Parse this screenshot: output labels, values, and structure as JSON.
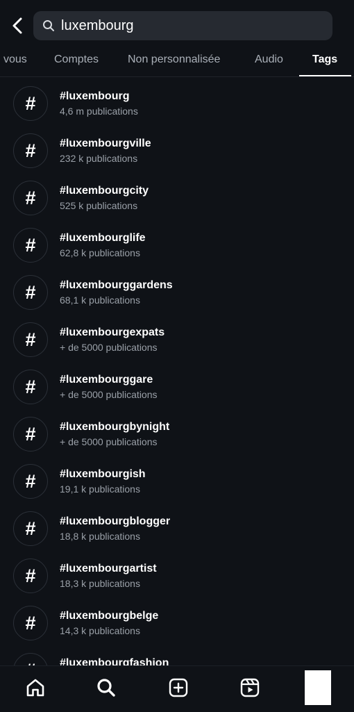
{
  "search": {
    "value": "luxembourg",
    "back_icon": "chevron-left-icon",
    "search_icon": "magnifier-icon"
  },
  "tabs": [
    {
      "label": "vous",
      "active": false
    },
    {
      "label": "Comptes",
      "active": false
    },
    {
      "label": "Non personnalisée",
      "active": false
    },
    {
      "label": "Audio",
      "active": false
    },
    {
      "label": "Tags",
      "active": true
    }
  ],
  "tag_symbol": "#",
  "results": [
    {
      "name": "#luxembourg",
      "count": "4,6 m publications"
    },
    {
      "name": "#luxembourgville",
      "count": "232 k publications"
    },
    {
      "name": "#luxembourgcity",
      "count": "525 k publications"
    },
    {
      "name": "#luxembourglife",
      "count": "62,8 k publications"
    },
    {
      "name": "#luxembourggardens",
      "count": "68,1 k publications"
    },
    {
      "name": "#luxembourgexpats",
      "count": "+ de 5000 publications"
    },
    {
      "name": "#luxembourggare",
      "count": "+ de 5000 publications"
    },
    {
      "name": "#luxembourgbynight",
      "count": "+ de 5000 publications"
    },
    {
      "name": "#luxembourgish",
      "count": "19,1 k publications"
    },
    {
      "name": "#luxembourgblogger",
      "count": "18,8 k publications"
    },
    {
      "name": "#luxembourgartist",
      "count": "18,3 k publications"
    },
    {
      "name": "#luxembourgbelge",
      "count": "14,3 k publications"
    },
    {
      "name": "#luxembourgfashion",
      "count": ""
    }
  ],
  "bottom_nav": [
    {
      "icon": "home-icon"
    },
    {
      "icon": "search-icon"
    },
    {
      "icon": "create-plus-icon"
    },
    {
      "icon": "reels-icon"
    },
    {
      "icon": "profile-avatar"
    }
  ],
  "colors": {
    "background": "#0f1217",
    "search_bg": "#262a31",
    "text_primary": "#ffffff",
    "text_secondary": "#9aa0a8",
    "tab_inactive": "#aab0b8"
  }
}
